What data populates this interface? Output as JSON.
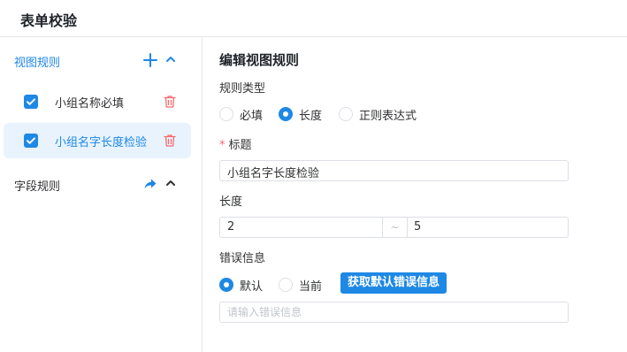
{
  "header": {
    "title": "表单校验"
  },
  "sidebar": {
    "view_rules": {
      "label": "视图规则",
      "items": [
        {
          "name": "小组名称必填",
          "checked": true,
          "active": false
        },
        {
          "name": "小组名字长度检验",
          "checked": true,
          "active": true
        }
      ]
    },
    "field_rules": {
      "label": "字段规则"
    }
  },
  "editor": {
    "title": "编辑视图规则",
    "rule_type": {
      "label": "规则类型",
      "options": [
        "必填",
        "长度",
        "正则表达式"
      ],
      "selected": "长度"
    },
    "title_field": {
      "required_mark": "*",
      "label": "标题",
      "value": "小组名字长度检验"
    },
    "length": {
      "label": "长度",
      "min": "2",
      "separator": "~",
      "max": "5"
    },
    "error_message": {
      "label": "错误信息",
      "options": [
        "默认",
        "当前"
      ],
      "selected": "默认",
      "fetch_button": "获取默认错误信息",
      "placeholder": "请输入错误信息"
    }
  },
  "colors": {
    "accent": "#1e88e5",
    "danger": "#f56c6c",
    "active_bg": "#e8f3fe"
  }
}
